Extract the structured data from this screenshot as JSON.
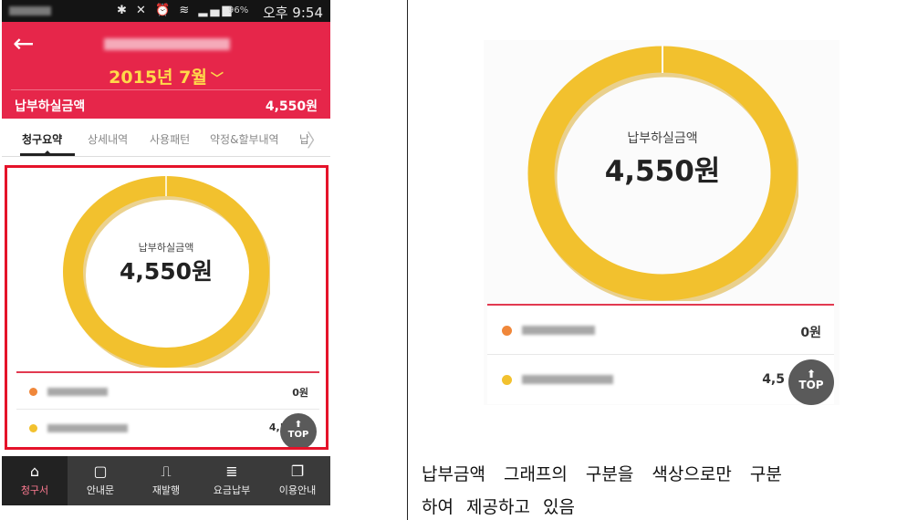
{
  "status_bar": {
    "icons": "✱ ✕ ⏰ ≋ ▂▄▆",
    "battery": "96%",
    "time": "오후 9:54"
  },
  "header": {
    "back_label": "←",
    "month": "2015년 7월",
    "unpaid_label": "납부하실금액",
    "unpaid_value": "4,550원"
  },
  "tabs": [
    {
      "label": "청구요약"
    },
    {
      "label": "상세내역"
    },
    {
      "label": "사용패턴"
    },
    {
      "label": "약정&할부내역"
    },
    {
      "label": "납"
    }
  ],
  "tab_more": "〉",
  "summary": {
    "label": "납부하실금액",
    "value": "4,550원"
  },
  "legend": [
    {
      "color": "#f0873a",
      "value": "0원"
    },
    {
      "color": "#f2c12e",
      "value": "4,550원"
    }
  ],
  "legend_left_partial": "4,55",
  "legend_right_partial": "4,5",
  "top_button": {
    "arrow": "⬆",
    "label": "TOP"
  },
  "bottom_nav": [
    {
      "icon": "⌂",
      "label": "청구서",
      "active": true
    },
    {
      "icon": "▢",
      "label": "안내문"
    },
    {
      "icon": "⎍",
      "label": "재발행"
    },
    {
      "icon": "≣",
      "label": "요금납부"
    },
    {
      "icon": "❐",
      "label": "이용안내"
    }
  ],
  "caption": {
    "line1": "납부금액 그래프의 구분을 색상으로만 구분",
    "line2": "하여 제공하고 있음"
  },
  "colors": {
    "header_red": "#e6264a",
    "month_yellow": "#ffd94a",
    "donut_yellow": "#f2c12e",
    "highlight_red": "#e5132a"
  }
}
